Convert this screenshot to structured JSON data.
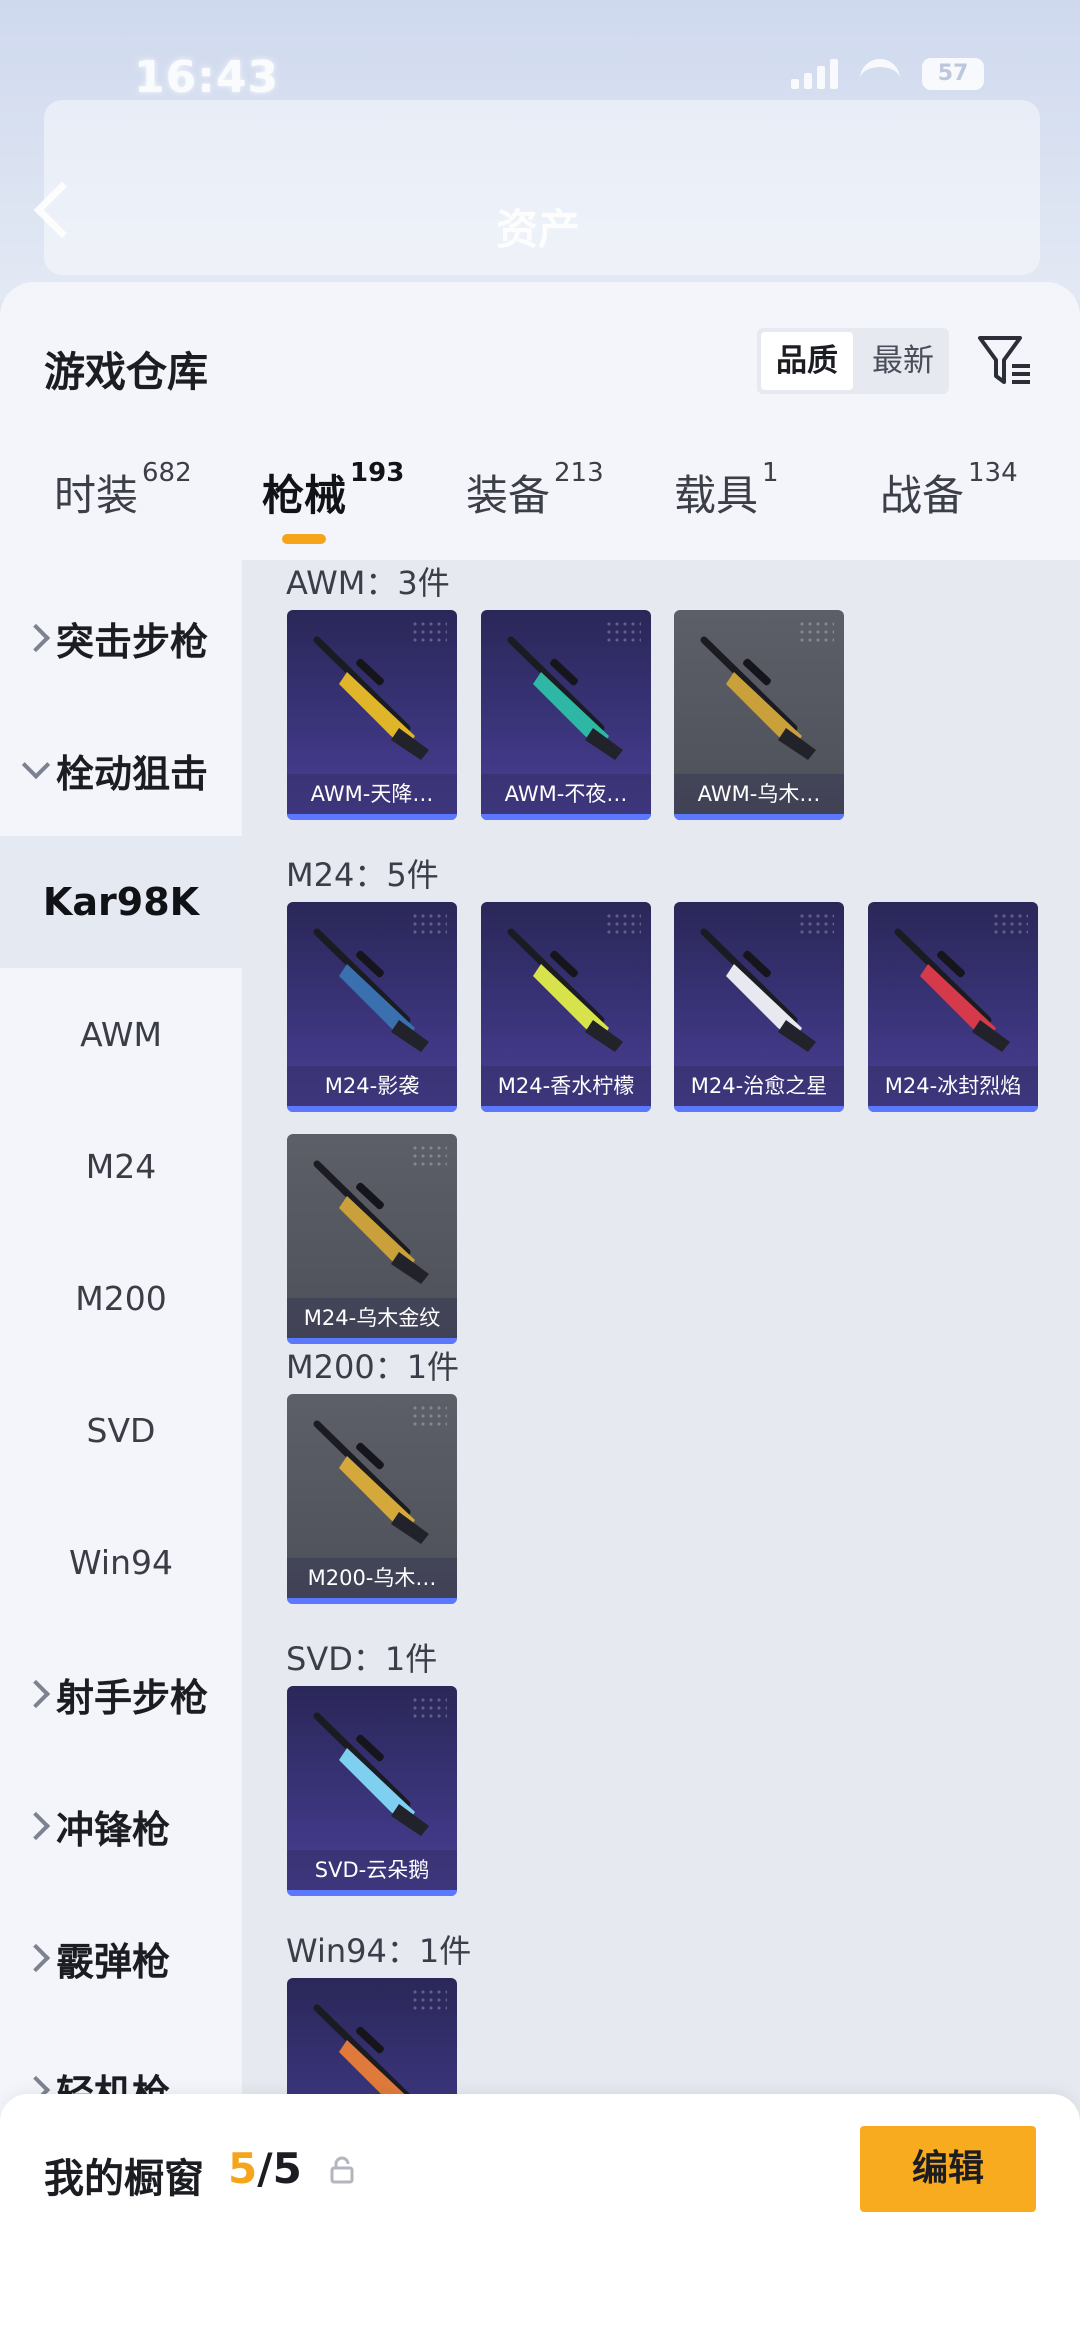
{
  "status_bar": {
    "time": "16:43",
    "battery": "57"
  },
  "nav": {
    "title": "资产"
  },
  "header": {
    "title": "游戏仓库",
    "sort_options": [
      "品质",
      "最新"
    ],
    "sort_selected": "品质"
  },
  "tabs": [
    {
      "label": "时装",
      "count": "682"
    },
    {
      "label": "枪械",
      "count": "193"
    },
    {
      "label": "装备",
      "count": "213"
    },
    {
      "label": "载具",
      "count": "1"
    },
    {
      "label": "战备",
      "count": "134"
    }
  ],
  "active_tab": "枪械",
  "sidebar": {
    "items": [
      {
        "label": "突击步枪",
        "type": "parent",
        "expanded": false
      },
      {
        "label": "栓动狙击",
        "type": "parent",
        "expanded": true
      },
      {
        "label": "Kar98K",
        "type": "child",
        "selected": true
      },
      {
        "label": "AWM",
        "type": "child"
      },
      {
        "label": "M24",
        "type": "child"
      },
      {
        "label": "M200",
        "type": "child"
      },
      {
        "label": "SVD",
        "type": "child"
      },
      {
        "label": "Win94",
        "type": "child"
      },
      {
        "label": "射手步枪",
        "type": "parent",
        "expanded": false
      },
      {
        "label": "冲锋枪",
        "type": "parent",
        "expanded": false
      },
      {
        "label": "霰弹枪",
        "type": "parent",
        "expanded": false
      },
      {
        "label": "轻机枪",
        "type": "parent",
        "expanded": false
      }
    ]
  },
  "groups": [
    {
      "title": "AWM：3件",
      "items": [
        {
          "name": "AWM-天降…",
          "bg": "purple",
          "gun_color": "#e0b52a"
        },
        {
          "name": "AWM-不夜…",
          "bg": "purple",
          "gun_color": "#2fb7a6"
        },
        {
          "name": "AWM-乌木…",
          "bg": "grey",
          "gun_color": "#c9a03a"
        }
      ]
    },
    {
      "title": "M24：5件",
      "items": [
        {
          "name": "M24-影袭",
          "bg": "purple",
          "gun_color": "#3a6fb0"
        },
        {
          "name": "M24-香水柠檬",
          "bg": "purple",
          "gun_color": "#d8e24a"
        },
        {
          "name": "M24-治愈之星",
          "bg": "purple",
          "gun_color": "#e8e8f0"
        },
        {
          "name": "M24-冰封烈焰",
          "bg": "purple",
          "gun_color": "#d63a4a"
        },
        {
          "name": "M24-乌木金纹",
          "bg": "grey",
          "gun_color": "#c9a03a"
        }
      ]
    },
    {
      "title": "M200：1件",
      "items": [
        {
          "name": "M200-乌木…",
          "bg": "grey",
          "gun_color": "#d4a83a"
        }
      ]
    },
    {
      "title": "SVD：1件",
      "items": [
        {
          "name": "SVD-云朵鹅",
          "bg": "purple",
          "gun_color": "#7fd0f0"
        }
      ]
    },
    {
      "title": "Win94：1件",
      "items": [
        {
          "name": "",
          "bg": "purple",
          "gun_color": "#e07a3a"
        }
      ]
    }
  ],
  "showcase": {
    "label": "我的橱窗",
    "current": "5",
    "total": "/5",
    "edit_label": "编辑"
  },
  "colors": {
    "accent": "#f5a51c",
    "card_purple": "#3a347a",
    "card_grey": "#55575f",
    "card_bar": "#5b78ff"
  }
}
